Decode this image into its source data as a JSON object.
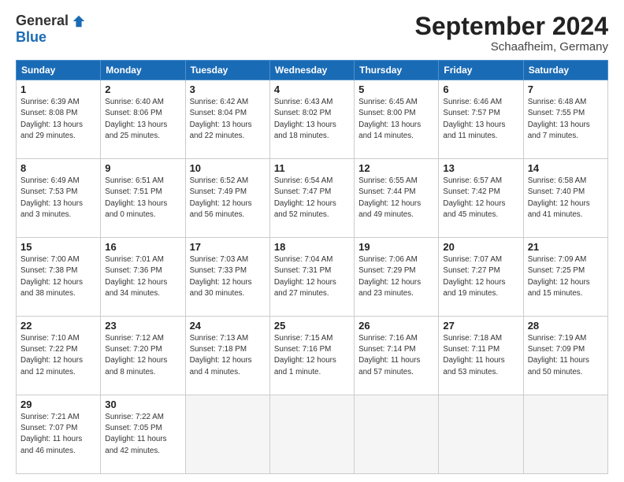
{
  "header": {
    "logo_general": "General",
    "logo_blue": "Blue",
    "month_title": "September 2024",
    "subtitle": "Schaafheim, Germany"
  },
  "weekdays": [
    "Sunday",
    "Monday",
    "Tuesday",
    "Wednesday",
    "Thursday",
    "Friday",
    "Saturday"
  ],
  "weeks": [
    [
      {
        "day": "1",
        "lines": [
          "Sunrise: 6:39 AM",
          "Sunset: 8:08 PM",
          "Daylight: 13 hours",
          "and 29 minutes."
        ]
      },
      {
        "day": "2",
        "lines": [
          "Sunrise: 6:40 AM",
          "Sunset: 8:06 PM",
          "Daylight: 13 hours",
          "and 25 minutes."
        ]
      },
      {
        "day": "3",
        "lines": [
          "Sunrise: 6:42 AM",
          "Sunset: 8:04 PM",
          "Daylight: 13 hours",
          "and 22 minutes."
        ]
      },
      {
        "day": "4",
        "lines": [
          "Sunrise: 6:43 AM",
          "Sunset: 8:02 PM",
          "Daylight: 13 hours",
          "and 18 minutes."
        ]
      },
      {
        "day": "5",
        "lines": [
          "Sunrise: 6:45 AM",
          "Sunset: 8:00 PM",
          "Daylight: 13 hours",
          "and 14 minutes."
        ]
      },
      {
        "day": "6",
        "lines": [
          "Sunrise: 6:46 AM",
          "Sunset: 7:57 PM",
          "Daylight: 13 hours",
          "and 11 minutes."
        ]
      },
      {
        "day": "7",
        "lines": [
          "Sunrise: 6:48 AM",
          "Sunset: 7:55 PM",
          "Daylight: 13 hours",
          "and 7 minutes."
        ]
      }
    ],
    [
      {
        "day": "8",
        "lines": [
          "Sunrise: 6:49 AM",
          "Sunset: 7:53 PM",
          "Daylight: 13 hours",
          "and 3 minutes."
        ]
      },
      {
        "day": "9",
        "lines": [
          "Sunrise: 6:51 AM",
          "Sunset: 7:51 PM",
          "Daylight: 13 hours",
          "and 0 minutes."
        ]
      },
      {
        "day": "10",
        "lines": [
          "Sunrise: 6:52 AM",
          "Sunset: 7:49 PM",
          "Daylight: 12 hours",
          "and 56 minutes."
        ]
      },
      {
        "day": "11",
        "lines": [
          "Sunrise: 6:54 AM",
          "Sunset: 7:47 PM",
          "Daylight: 12 hours",
          "and 52 minutes."
        ]
      },
      {
        "day": "12",
        "lines": [
          "Sunrise: 6:55 AM",
          "Sunset: 7:44 PM",
          "Daylight: 12 hours",
          "and 49 minutes."
        ]
      },
      {
        "day": "13",
        "lines": [
          "Sunrise: 6:57 AM",
          "Sunset: 7:42 PM",
          "Daylight: 12 hours",
          "and 45 minutes."
        ]
      },
      {
        "day": "14",
        "lines": [
          "Sunrise: 6:58 AM",
          "Sunset: 7:40 PM",
          "Daylight: 12 hours",
          "and 41 minutes."
        ]
      }
    ],
    [
      {
        "day": "15",
        "lines": [
          "Sunrise: 7:00 AM",
          "Sunset: 7:38 PM",
          "Daylight: 12 hours",
          "and 38 minutes."
        ]
      },
      {
        "day": "16",
        "lines": [
          "Sunrise: 7:01 AM",
          "Sunset: 7:36 PM",
          "Daylight: 12 hours",
          "and 34 minutes."
        ]
      },
      {
        "day": "17",
        "lines": [
          "Sunrise: 7:03 AM",
          "Sunset: 7:33 PM",
          "Daylight: 12 hours",
          "and 30 minutes."
        ]
      },
      {
        "day": "18",
        "lines": [
          "Sunrise: 7:04 AM",
          "Sunset: 7:31 PM",
          "Daylight: 12 hours",
          "and 27 minutes."
        ]
      },
      {
        "day": "19",
        "lines": [
          "Sunrise: 7:06 AM",
          "Sunset: 7:29 PM",
          "Daylight: 12 hours",
          "and 23 minutes."
        ]
      },
      {
        "day": "20",
        "lines": [
          "Sunrise: 7:07 AM",
          "Sunset: 7:27 PM",
          "Daylight: 12 hours",
          "and 19 minutes."
        ]
      },
      {
        "day": "21",
        "lines": [
          "Sunrise: 7:09 AM",
          "Sunset: 7:25 PM",
          "Daylight: 12 hours",
          "and 15 minutes."
        ]
      }
    ],
    [
      {
        "day": "22",
        "lines": [
          "Sunrise: 7:10 AM",
          "Sunset: 7:22 PM",
          "Daylight: 12 hours",
          "and 12 minutes."
        ]
      },
      {
        "day": "23",
        "lines": [
          "Sunrise: 7:12 AM",
          "Sunset: 7:20 PM",
          "Daylight: 12 hours",
          "and 8 minutes."
        ]
      },
      {
        "day": "24",
        "lines": [
          "Sunrise: 7:13 AM",
          "Sunset: 7:18 PM",
          "Daylight: 12 hours",
          "and 4 minutes."
        ]
      },
      {
        "day": "25",
        "lines": [
          "Sunrise: 7:15 AM",
          "Sunset: 7:16 PM",
          "Daylight: 12 hours",
          "and 1 minute."
        ]
      },
      {
        "day": "26",
        "lines": [
          "Sunrise: 7:16 AM",
          "Sunset: 7:14 PM",
          "Daylight: 11 hours",
          "and 57 minutes."
        ]
      },
      {
        "day": "27",
        "lines": [
          "Sunrise: 7:18 AM",
          "Sunset: 7:11 PM",
          "Daylight: 11 hours",
          "and 53 minutes."
        ]
      },
      {
        "day": "28",
        "lines": [
          "Sunrise: 7:19 AM",
          "Sunset: 7:09 PM",
          "Daylight: 11 hours",
          "and 50 minutes."
        ]
      }
    ],
    [
      {
        "day": "29",
        "lines": [
          "Sunrise: 7:21 AM",
          "Sunset: 7:07 PM",
          "Daylight: 11 hours",
          "and 46 minutes."
        ]
      },
      {
        "day": "30",
        "lines": [
          "Sunrise: 7:22 AM",
          "Sunset: 7:05 PM",
          "Daylight: 11 hours",
          "and 42 minutes."
        ]
      },
      null,
      null,
      null,
      null,
      null
    ]
  ]
}
